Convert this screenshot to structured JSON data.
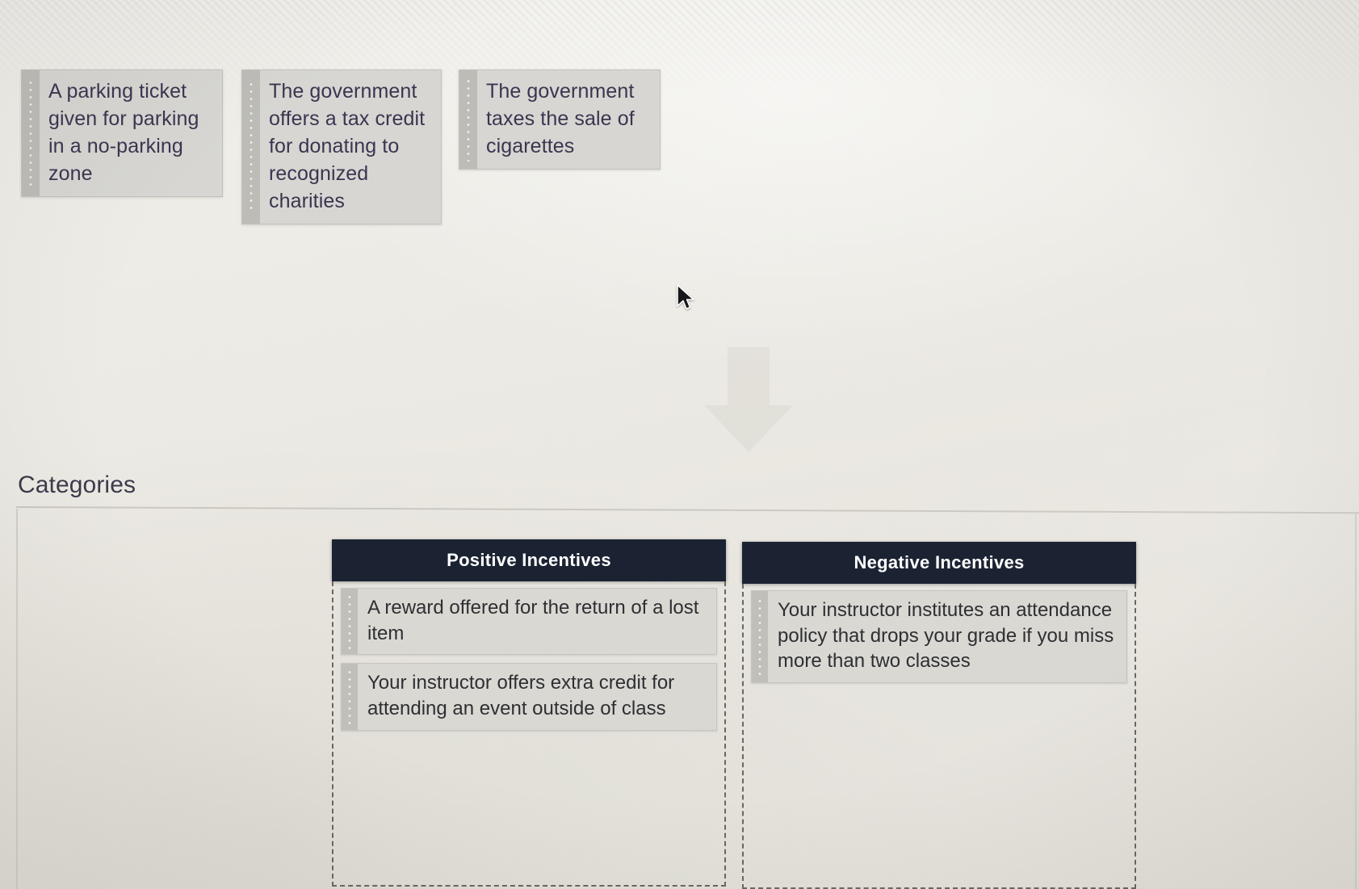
{
  "tray": {
    "items": [
      {
        "text": "A parking ticket given for parking in a no-parking zone"
      },
      {
        "text": "The government offers a tax credit for donating to recognized charities"
      },
      {
        "text": "The government taxes the sale of cigarettes"
      }
    ]
  },
  "categories_section": {
    "heading": "Categories",
    "columns": [
      {
        "title": "Positive Incentives",
        "items": [
          {
            "text": "A reward offered for the return of a lost item"
          },
          {
            "text": "Your instructor offers extra credit for attending an event outside of class"
          }
        ]
      },
      {
        "title": "Negative Incentives",
        "items": [
          {
            "text": "Your instructor institutes an attendance policy that drops your grade if you miss more than two classes"
          }
        ]
      }
    ]
  },
  "colors": {
    "header_bg": "#1b2333",
    "header_text": "#ffffff",
    "card_bg": "#d7d6d2",
    "grip_bg": "#bdbcb7",
    "tray_text": "#3b3550",
    "dropped_text": "#2f2f33",
    "dropzone_border": "#6a675f",
    "page_bg": "#eceae5"
  },
  "icons": {
    "grip": "drag-grip-icon",
    "cursor": "mouse-pointer-icon",
    "watermark": "down-arrow-watermark-icon"
  }
}
